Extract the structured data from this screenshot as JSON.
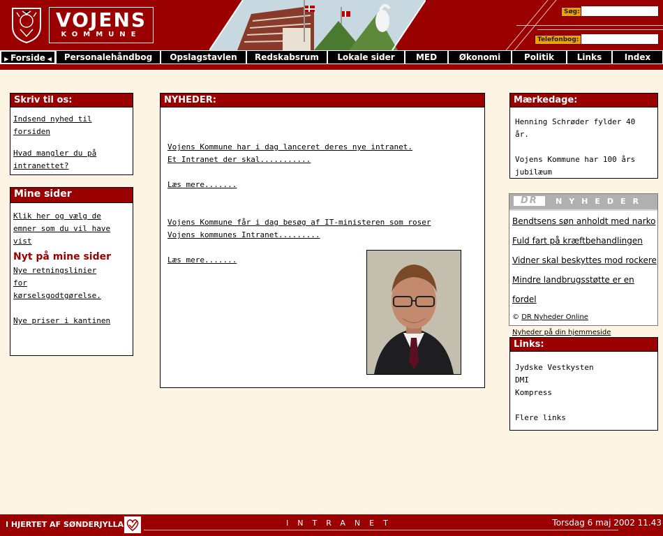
{
  "header": {
    "logo_title": "VOJENS",
    "logo_subtitle": "KOMMUNE",
    "search_label": "Søg:",
    "search_value": "",
    "phonebook_label": "Telefonbog:",
    "phonebook_value": ""
  },
  "nav": {
    "items": [
      {
        "label": "Forside"
      },
      {
        "label": "Personalehåndbog"
      },
      {
        "label": "Opslagstavlen"
      },
      {
        "label": "Redskabsrum"
      },
      {
        "label": "Lokale sider"
      },
      {
        "label": "MED"
      },
      {
        "label": "Økonomi"
      },
      {
        "label": "Politik"
      },
      {
        "label": "Links"
      },
      {
        "label": "Index"
      }
    ]
  },
  "write_us": {
    "title": "Skriv til os:",
    "link1": "Indsend nyhed til forsiden",
    "link2": "Hvad mangler du på intranettet?"
  },
  "my_pages": {
    "title": "Mine sider",
    "link1": "Klik her og vælg de emner som du vil have vist",
    "new_heading": "Nyt på mine sider",
    "link2": "Nye retningslinier for kørselsgodtgørelse.",
    "link3": "Nye priser i kantinen"
  },
  "news": {
    "title": "NYHEDER:",
    "item1_line1": "Vojens Kommune har i dag lanceret deres nye intranet.",
    "item1_line2": "Et Intranet der skal...........",
    "item1_more": "Læs mere.......",
    "item2_line1": "Vojens Kommune får i dag besøg af IT-ministeren som roser",
    "item2_line2": "Vojens kommunes Intranet.........",
    "item2_more": "Læs mere......."
  },
  "notable_days": {
    "title": "Mærkedage:",
    "item1": "Henning Schrøder fylder 40 år.",
    "item2": "Vojens Kommune har 100 års jubilæum"
  },
  "dr_news": {
    "logo": "DR",
    "header": "NYHEDER",
    "items": [
      {
        "label": "Bendtsens søn anholdt med narko"
      },
      {
        "label": "Fuld fart på kræftbehandlingen"
      },
      {
        "label": "Vidner skal beskyttes mod rockere"
      },
      {
        "label": "Mindre landbrugsstøtte er en fordel"
      }
    ],
    "copyright_symbol": "©",
    "source_link": "DR Nyheder Online",
    "homepage_link": "Nyheder på din hjemmeside"
  },
  "links_box": {
    "title": "Links:",
    "items": [
      {
        "label": "Jydske Vestkysten"
      },
      {
        "label": "DMI"
      },
      {
        "label": "Kompress"
      }
    ],
    "more": "Flere links"
  },
  "footer": {
    "slogan": "I HJERTET AF SØNDERJYLLAND",
    "center": "INTRANET",
    "datetime": "Torsdag 6 maj 2002 11.43"
  },
  "colors": {
    "brand": "#9b0000",
    "background": "#fdf4e3",
    "search_label_bg": "#f0a000"
  }
}
